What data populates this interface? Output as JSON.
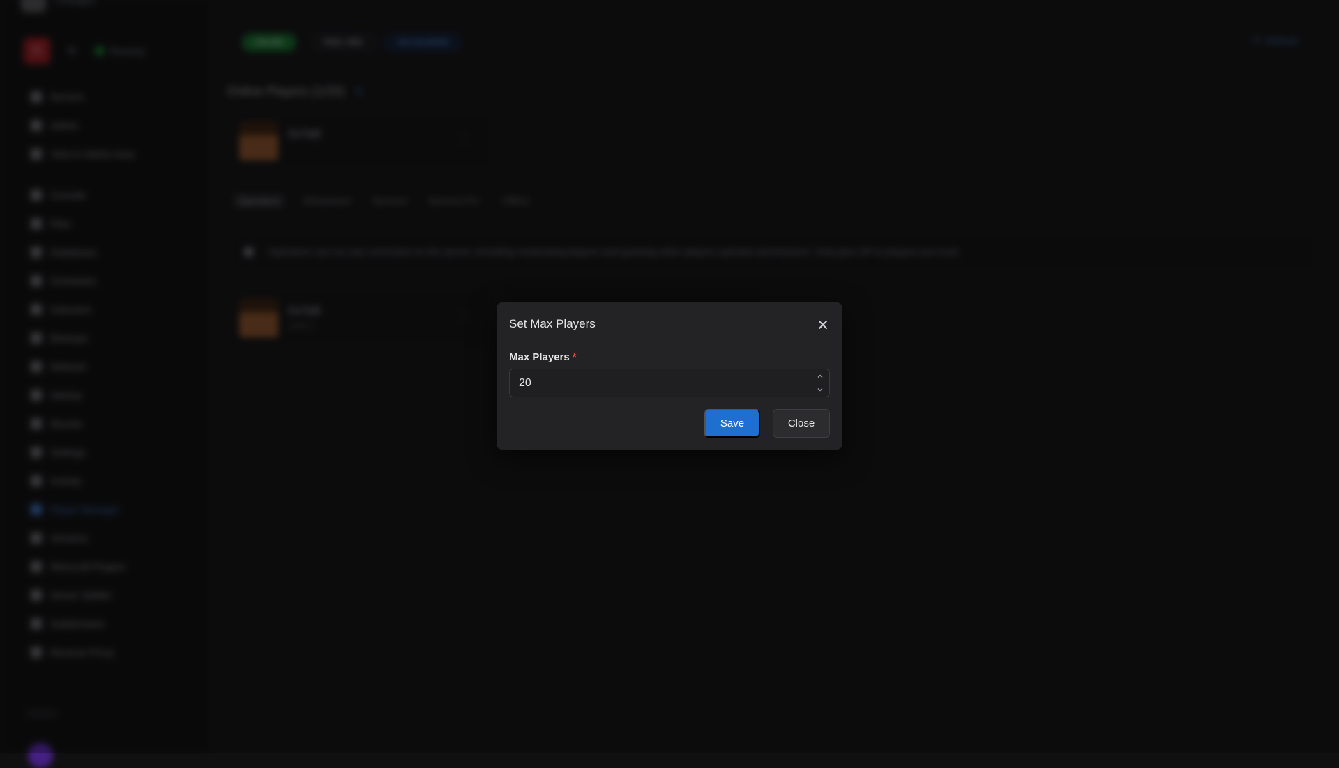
{
  "sidebar": {
    "server_name": "Chungus",
    "status": "Running",
    "nav": [
      {
        "label": "Servers",
        "icon": "server-icon"
      },
      {
        "label": "Admin",
        "icon": "shield-icon"
      },
      {
        "label": "View in Admin Area",
        "icon": "external-link-icon"
      },
      {
        "label": "Console",
        "icon": "terminal-icon"
      },
      {
        "label": "Files",
        "icon": "folder-icon"
      },
      {
        "label": "Databases",
        "icon": "database-icon"
      },
      {
        "label": "Schedules",
        "icon": "clock-icon"
      },
      {
        "label": "Subusers",
        "icon": "users-icon"
      },
      {
        "label": "Backups",
        "icon": "archive-icon"
      },
      {
        "label": "Network",
        "icon": "network-icon"
      },
      {
        "label": "Startup",
        "icon": "play-icon"
      },
      {
        "label": "Mounts",
        "icon": "hard-drive-icon"
      },
      {
        "label": "Settings",
        "icon": "gear-icon"
      },
      {
        "label": "Activity",
        "icon": "activity-icon"
      },
      {
        "label": "Player Manager",
        "icon": "user-icon"
      },
      {
        "label": "Versions",
        "icon": "tag-icon"
      },
      {
        "label": "Minecraft Plugins",
        "icon": "plug-icon"
      },
      {
        "label": "Server Splitter",
        "icon": "split-icon"
      },
      {
        "label": "Subdomains",
        "icon": "globe-icon"
      },
      {
        "label": "Reverse Proxy",
        "icon": "proxy-icon"
      }
    ],
    "footer_label": "Version"
  },
  "topbar": {
    "status_pill": "ONLINE",
    "ping_pill": "PING: 9MS",
    "ip_pill": "ON LIN MODE",
    "refresh_label": "Refresh"
  },
  "online_players": {
    "title": "Online Players (1/20)",
    "players": [
      {
        "name": "DxTaB"
      }
    ]
  },
  "tabs": [
    "Operators",
    "Whitelisted",
    "Banned",
    "Banned IPs",
    "Offline"
  ],
  "info_banner": "Operators can run any command on the server, including moderating players and granting other players operator permissions. Only give OP to players you trust.",
  "operators": [
    {
      "name": "DxTaB",
      "sub": "Level 4"
    }
  ],
  "modal": {
    "title": "Set Max Players",
    "field_label": "Max Players",
    "required_mark": "*",
    "value": "20",
    "save_label": "Save",
    "close_label": "Close"
  },
  "colors": {
    "primary": "#1f6fd1",
    "danger": "#ef4444",
    "online": "#1f8a3a"
  }
}
